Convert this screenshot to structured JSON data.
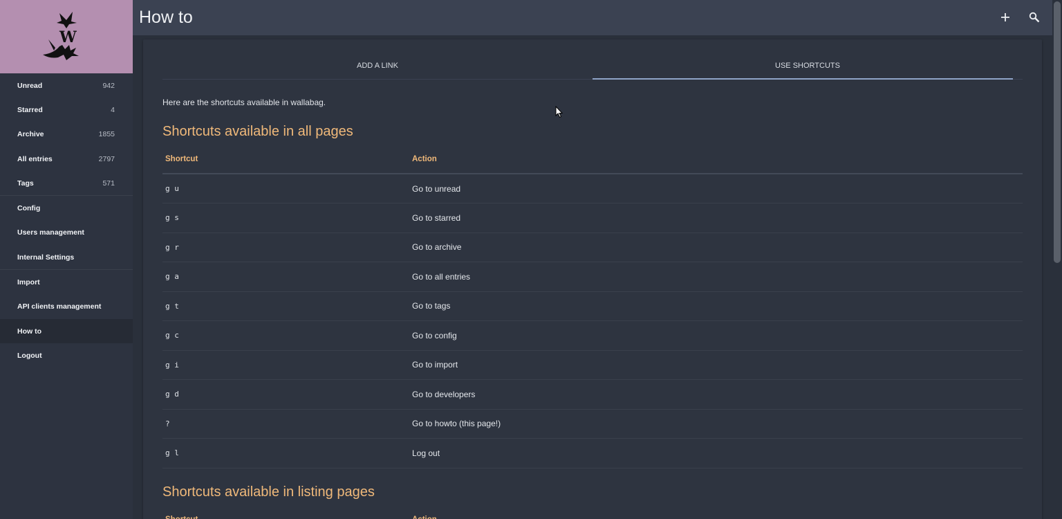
{
  "header": {
    "title": "How to"
  },
  "sidebar": {
    "items": [
      {
        "label": "Unread",
        "count": "942"
      },
      {
        "label": "Starred",
        "count": "4"
      },
      {
        "label": "Archive",
        "count": "1855"
      },
      {
        "label": "All entries",
        "count": "2797"
      },
      {
        "label": "Tags",
        "count": "571"
      },
      {
        "label": "Config",
        "count": ""
      },
      {
        "label": "Users management",
        "count": ""
      },
      {
        "label": "Internal Settings",
        "count": ""
      },
      {
        "label": "Import",
        "count": ""
      },
      {
        "label": "API clients management",
        "count": ""
      },
      {
        "label": "How to",
        "count": ""
      },
      {
        "label": "Logout",
        "count": ""
      }
    ]
  },
  "tabs": [
    {
      "label": "ADD A LINK"
    },
    {
      "label": "USE SHORTCUTS"
    }
  ],
  "main": {
    "intro": "Here are the shortcuts available in wallabag.",
    "section1_title": "Shortcuts available in all pages",
    "section2_title": "Shortcuts available in listing pages",
    "col_shortcut": "Shortcut",
    "col_action": "Action",
    "shortcuts": [
      {
        "key": "g u",
        "action": "Go to unread"
      },
      {
        "key": "g s",
        "action": "Go to starred"
      },
      {
        "key": "g r",
        "action": "Go to archive"
      },
      {
        "key": "g a",
        "action": "Go to all entries"
      },
      {
        "key": "g t",
        "action": "Go to tags"
      },
      {
        "key": "g c",
        "action": "Go to config"
      },
      {
        "key": "g i",
        "action": "Go to import"
      },
      {
        "key": "g d",
        "action": "Go to developers"
      },
      {
        "key": "?",
        "action": "Go to howto (this page!)"
      },
      {
        "key": "g l",
        "action": "Log out"
      }
    ]
  },
  "icons": {
    "add": "plus-icon",
    "search": "search-icon",
    "logo": "wallabag-logo"
  },
  "colors": {
    "accent": "#f0b97a",
    "logo_bg": "#b48fb0",
    "tab_indicator": "#8fa4c8"
  }
}
